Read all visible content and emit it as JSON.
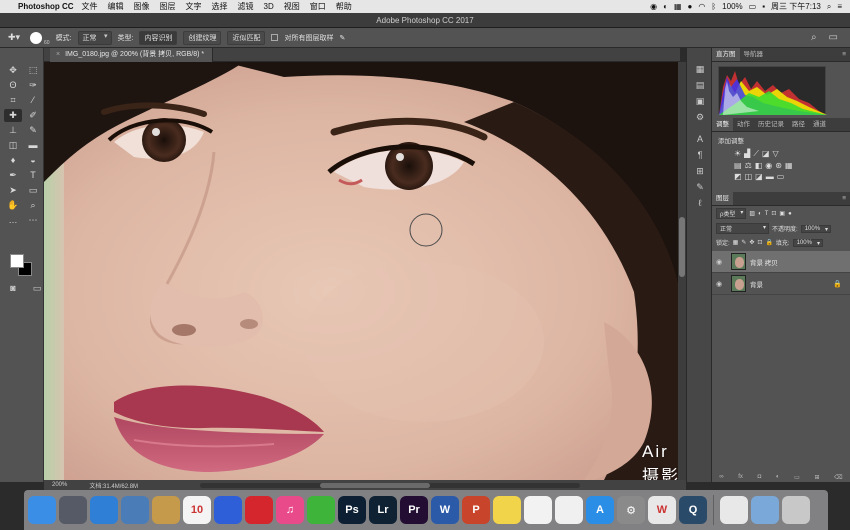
{
  "menubar": {
    "app_name": "Photoshop CC",
    "menus": [
      "文件",
      "编辑",
      "图像",
      "图层",
      "文字",
      "选择",
      "滤镜",
      "3D",
      "视图",
      "窗口",
      "帮助"
    ],
    "battery": "100%",
    "clock": "周三 下午7:13"
  },
  "window_title": "Adobe Photoshop CC 2017",
  "options": {
    "brush_size": "60",
    "mode_label": "模式:",
    "mode_value": "正常",
    "type_label": "类型:",
    "type_buttons": [
      "内容识别",
      "创建纹理",
      "近似匹配"
    ],
    "sample_all_label": "对所有图层取样"
  },
  "document": {
    "tab_label": "IMG_0180.jpg @ 200% (背景 拷贝, RGB/8) *",
    "zoom": "200%",
    "doc_size": "文档:31.4M/62.8M",
    "watermark": "Air摄影学院"
  },
  "panels": {
    "top_tabs": [
      "直方图",
      "导航器"
    ],
    "mid_tabs": [
      "调整",
      "动作",
      "历史记录",
      "路径",
      "通道"
    ],
    "adjust_title": "添加调整",
    "layers_tab": "图层",
    "kind_filter": "ρ类型",
    "blend_mode": "正常",
    "opacity_label": "不透明度:",
    "opacity_value": "100%",
    "lock_label": "锁定:",
    "fill_label": "填充:",
    "fill_value": "100%",
    "layers": [
      {
        "name": "背景 拷贝",
        "selected": true,
        "locked": false
      },
      {
        "name": "背景",
        "selected": false,
        "locked": true
      }
    ]
  },
  "dock": {
    "calendar_day": "10",
    "apps": [
      {
        "name": "finder",
        "label": "",
        "color": "#3a8ee6"
      },
      {
        "name": "launchpad",
        "label": "",
        "color": "#555a66"
      },
      {
        "name": "safari",
        "label": "",
        "color": "#2f7fd6"
      },
      {
        "name": "preview",
        "label": "",
        "color": "#4a7db8"
      },
      {
        "name": "notes",
        "label": "",
        "color": "#c59a4a"
      },
      {
        "name": "calendar",
        "label": "10",
        "color": "#f4f4f4"
      },
      {
        "name": "baidu",
        "label": "",
        "color": "#2f5fd8"
      },
      {
        "name": "netease-music",
        "label": "",
        "color": "#d4262c"
      },
      {
        "name": "itunes",
        "label": "♫",
        "color": "#e84a8a"
      },
      {
        "name": "wechat",
        "label": "",
        "color": "#3eb53a"
      },
      {
        "name": "photoshop",
        "label": "Ps",
        "color": "#0d1f33"
      },
      {
        "name": "lightroom",
        "label": "Lr",
        "color": "#0f2233"
      },
      {
        "name": "premiere",
        "label": "Pr",
        "color": "#230d33"
      },
      {
        "name": "word",
        "label": "W",
        "color": "#2b5aa8"
      },
      {
        "name": "powerpoint",
        "label": "P",
        "color": "#c8442a"
      },
      {
        "name": "stickies",
        "label": "",
        "color": "#f2d44a"
      },
      {
        "name": "reminders",
        "label": "",
        "color": "#f2f2f2"
      },
      {
        "name": "photos",
        "label": "",
        "color": "#f0f0f0"
      },
      {
        "name": "app-store",
        "label": "A",
        "color": "#2a8de6"
      },
      {
        "name": "system-preferences",
        "label": "⚙",
        "color": "#8a8a8a"
      },
      {
        "name": "wps",
        "label": "W",
        "color": "#e8e8e8"
      },
      {
        "name": "quicktime",
        "label": "Q",
        "color": "#2a4a6a"
      },
      {
        "name": "documents",
        "label": "",
        "color": "#e8e8e8"
      },
      {
        "name": "downloads",
        "label": "",
        "color": "#7aa8d8"
      },
      {
        "name": "trash",
        "label": "",
        "color": "#c8c8c8"
      }
    ]
  }
}
